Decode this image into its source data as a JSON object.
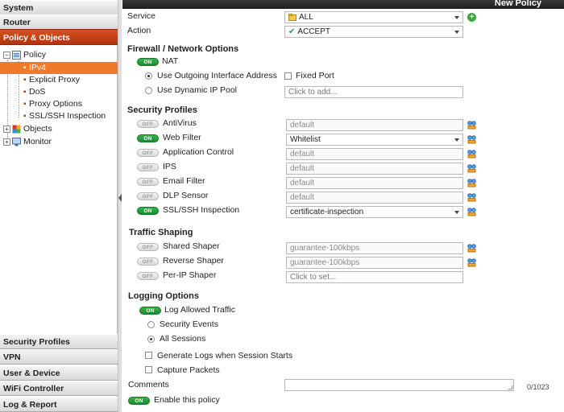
{
  "sidebar": {
    "sections_top": [
      "System",
      "Router",
      "Policy & Objects"
    ],
    "tree": {
      "policy": "Policy",
      "policy_children": [
        "IPv4",
        "Explicit Proxy",
        "DoS",
        "Proxy Options",
        "SSL/SSH Inspection"
      ],
      "objects": "Objects",
      "monitor": "Monitor"
    },
    "sections_bottom": [
      "Security Profiles",
      "VPN",
      "User & Device",
      "WiFi Controller",
      "Log & Report"
    ]
  },
  "titlebar": {
    "title": "New Policy"
  },
  "form": {
    "service": {
      "label": "Service",
      "value": "ALL"
    },
    "action": {
      "label": "Action",
      "value": "ACCEPT"
    },
    "firewall": {
      "heading": "Firewall / Network Options",
      "nat_label": "NAT",
      "nat_state": "ON",
      "use_outgoing": "Use Outgoing Interface Address",
      "fixed_port": "Fixed Port",
      "use_dynamic": "Use Dynamic IP Pool",
      "dynamic_placeholder": "Click to add..."
    },
    "security_profiles": {
      "heading": "Security Profiles",
      "items": [
        {
          "label": "AntiVirus",
          "state": "OFF",
          "value": "default"
        },
        {
          "label": "Web Filter",
          "state": "ON",
          "value": "Whitelist"
        },
        {
          "label": "Application Control",
          "state": "OFF",
          "value": "default"
        },
        {
          "label": "IPS",
          "state": "OFF",
          "value": "default"
        },
        {
          "label": "Email Filter",
          "state": "OFF",
          "value": "default"
        },
        {
          "label": "DLP Sensor",
          "state": "OFF",
          "value": "default"
        },
        {
          "label": "SSL/SSH Inspection",
          "state": "ON",
          "value": "certificate-inspection"
        }
      ]
    },
    "traffic_shaping": {
      "heading": "Traffic Shaping",
      "items": [
        {
          "label": "Shared Shaper",
          "state": "OFF",
          "value": "guarantee-100kbps"
        },
        {
          "label": "Reverse Shaper",
          "state": "OFF",
          "value": "guarantee-100kbps"
        },
        {
          "label": "Per-IP Shaper",
          "state": "OFF",
          "value": "Click to set..."
        }
      ]
    },
    "logging": {
      "heading": "Logging Options",
      "log_allowed": "Log Allowed Traffic",
      "log_state": "ON",
      "security_events": "Security Events",
      "all_sessions": "All Sessions",
      "generate_logs": "Generate Logs when Session Starts",
      "capture_packets": "Capture Packets"
    },
    "comments": {
      "label": "Comments",
      "counter": "0/1023"
    },
    "enable": {
      "label": "Enable this policy",
      "state": "ON"
    }
  },
  "colors": {
    "accent_orange": "#f07a2c",
    "active_nav": "#c2421a",
    "toggle_on": "#2a9d3a"
  },
  "icons": {
    "service": "address-object-icon",
    "action": "checkmark-icon",
    "add": "plus-icon",
    "edit": "edit-profile-icon"
  }
}
